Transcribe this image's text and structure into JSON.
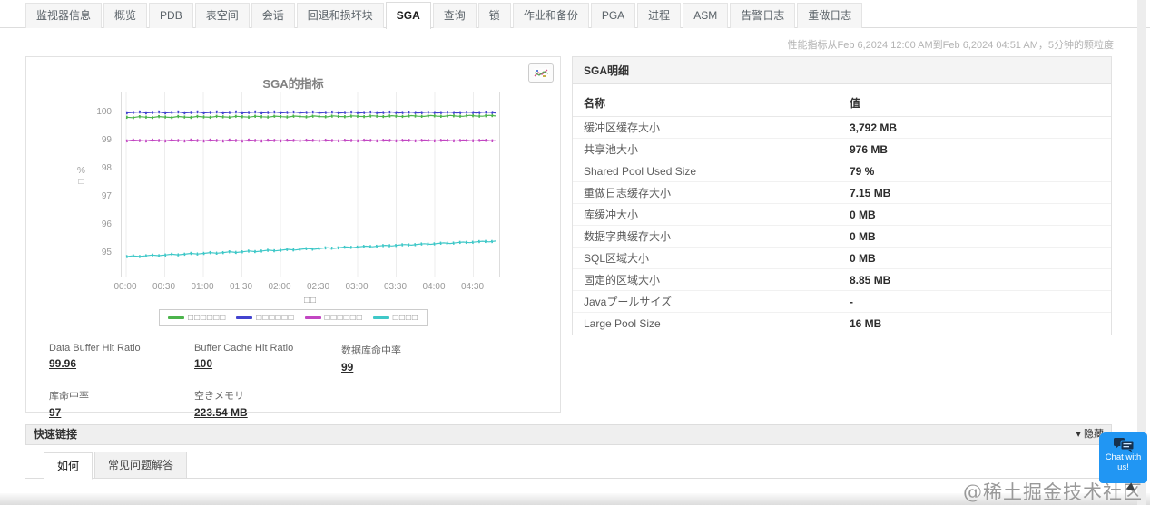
{
  "tabs": {
    "active_index": 6,
    "items": [
      {
        "label": "监视器信息"
      },
      {
        "label": "概览"
      },
      {
        "label": "PDB"
      },
      {
        "label": "表空间"
      },
      {
        "label": "会话"
      },
      {
        "label": "回退和损坏块"
      },
      {
        "label": "SGA"
      },
      {
        "label": "查询"
      },
      {
        "label": "锁"
      },
      {
        "label": "作业和备份"
      },
      {
        "label": "PGA"
      },
      {
        "label": "进程"
      },
      {
        "label": "ASM"
      },
      {
        "label": "告警日志"
      },
      {
        "label": "重做日志"
      }
    ]
  },
  "header": {
    "perf_note": "性能指标从Feb 6,2024 12:00 AM到Feb 6,2024 04:51 AM，5分钟的颗粒度"
  },
  "chart_data": {
    "type": "line",
    "title": "SGA的指标",
    "ylabel": "%",
    "ylabel_box": "□",
    "xlabel": "□□",
    "x_ticks": [
      "00:00",
      "00:30",
      "01:00",
      "01:30",
      "02:00",
      "02:30",
      "03:00",
      "03:30",
      "04:00",
      "04:30"
    ],
    "y_ticks": [
      95,
      96,
      97,
      98,
      99,
      100
    ],
    "ylim": [
      94.3,
      100.7
    ],
    "legend_position": "bottom",
    "grid": "vertical",
    "series": [
      {
        "name": "□□□□□□",
        "color": "#4cb44c",
        "start": 99.83,
        "end": 99.88
      },
      {
        "name": "□□□□□□",
        "color": "#4343cf",
        "start": 100.0,
        "end": 100.0
      },
      {
        "name": "□□□□□□",
        "color": "#c246c2",
        "start": 99.0,
        "end": 99.0
      },
      {
        "name": "□□□□",
        "color": "#3fc8c8",
        "start": 94.87,
        "end": 95.42
      }
    ]
  },
  "chart_panel": {
    "chart_button_icon": "mini-chart-icon",
    "stats": [
      {
        "label": "Data Buffer Hit Ratio",
        "value": "99.96"
      },
      {
        "label": "Buffer Cache Hit Ratio",
        "value": "100"
      },
      {
        "label": "数据库命中率",
        "value": "99"
      },
      {
        "label": "库命中率",
        "value": "97"
      },
      {
        "label": "空きメモリ",
        "value": "223.54 MB"
      }
    ]
  },
  "details_panel": {
    "title": "SGA明细",
    "columns": [
      "名称",
      "值"
    ],
    "rows": [
      {
        "name": "缓冲区缓存大小",
        "value": "3,792 MB"
      },
      {
        "name": "共享池大小",
        "value": "976 MB"
      },
      {
        "name": "Shared Pool Used Size",
        "value": "79 %"
      },
      {
        "name": "重做日志缓存大小",
        "value": "7.15 MB"
      },
      {
        "name": "库缓冲大小",
        "value": "0 MB"
      },
      {
        "name": "数据字典缓存大小",
        "value": "0 MB"
      },
      {
        "name": "SQL区域大小",
        "value": "0 MB"
      },
      {
        "name": "固定的区域大小",
        "value": "8.85 MB"
      },
      {
        "name": "Javaプールサイズ",
        "value": "-"
      },
      {
        "name": "Large Pool Size",
        "value": "16 MB"
      }
    ]
  },
  "quick_links": {
    "title": "快速链接",
    "hide_caret": "▾",
    "hide_label": "隐藏",
    "tabs": [
      {
        "label": "如何",
        "active": true
      },
      {
        "label": "常见问题解答",
        "active": false
      }
    ]
  },
  "chat": {
    "label": "Chat with us!"
  },
  "watermark": "@稀土掘金技术社区",
  "colors": {
    "accent_blue": "#2196f3",
    "tab_bg": "#f6f6f6",
    "panel_border": "#e2e2e2",
    "header_bg": "#f4f4f4"
  }
}
